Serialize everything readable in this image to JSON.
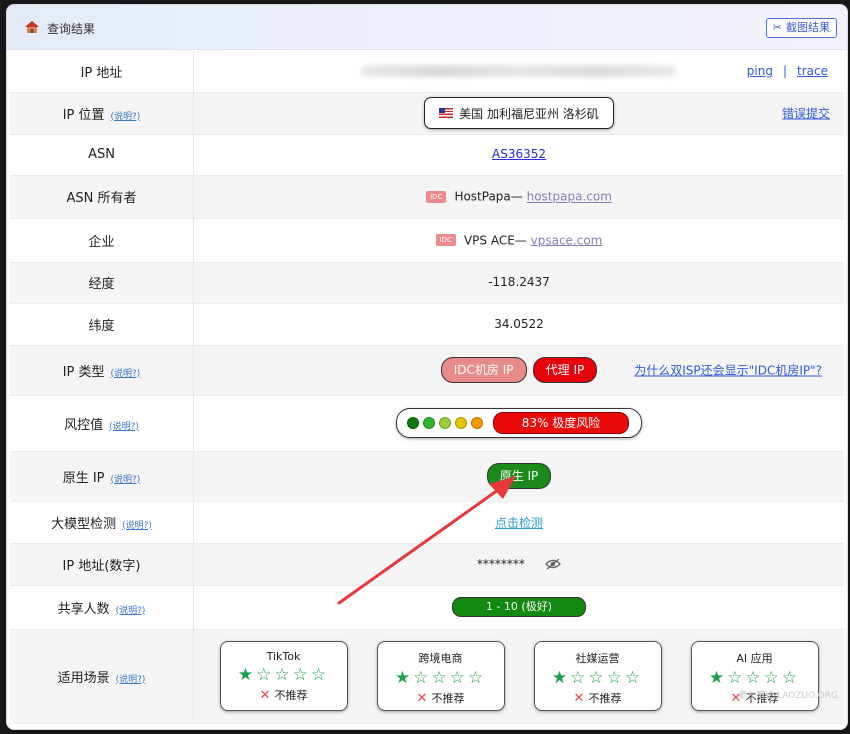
{
  "header": {
    "title": "查询结果",
    "screenshot_btn": "截图结果",
    "icon": "house-icon"
  },
  "help_label": "(说明?)",
  "rows": {
    "ip_address": {
      "label": "IP 地址",
      "ping": "ping",
      "sep": "|",
      "trace": "trace"
    },
    "ip_location": {
      "label": "IP 位置",
      "value": "美国 加利福尼亚州 洛杉矶",
      "report": "错误提交"
    },
    "asn": {
      "label": "ASN",
      "value": "AS36352"
    },
    "asn_owner": {
      "label": "ASN 所有者",
      "tag": "IDC",
      "name": "HostPapa—",
      "domain": "hostpapa.com"
    },
    "company": {
      "label": "企业",
      "tag": "IDC",
      "name": "VPS ACE—",
      "domain": "vpsace.com"
    },
    "longitude": {
      "label": "经度",
      "value": "-118.2437"
    },
    "latitude": {
      "label": "纬度",
      "value": "34.0522"
    },
    "ip_type": {
      "label": "IP 类型",
      "tag1": "IDC机房 IP",
      "tag2": "代理 IP",
      "link": "为什么双ISP还会显示\"IDC机房IP\"?"
    },
    "risk": {
      "label": "风控值",
      "value": "83%  极度风险",
      "score": 83,
      "dots": [
        "#0d7a0d",
        "#2fb52f",
        "#9ccc3a",
        "#e4c400",
        "#f29a00"
      ]
    },
    "native_ip": {
      "label": "原生 IP",
      "value": "原生 IP"
    },
    "llm_check": {
      "label": "大模型检测",
      "value": "点击检测"
    },
    "ip_numeric": {
      "label": "IP 地址(数字)",
      "value": "********"
    },
    "shared_users": {
      "label": "共享人数",
      "value": "1 - 10 (极好)"
    },
    "scenarios": {
      "label": "适用场景",
      "items": [
        {
          "name": "TikTok",
          "stars_filled": 1,
          "stars_total": 5,
          "verdict": "不推荐"
        },
        {
          "name": "跨境电商",
          "stars_filled": 1,
          "stars_total": 5,
          "verdict": "不推荐"
        },
        {
          "name": "社媒运营",
          "stars_filled": 1,
          "stars_total": 5,
          "verdict": "不推荐"
        },
        {
          "name": "AI 应用",
          "stars_filled": 1,
          "stars_total": 5,
          "verdict": "不推荐"
        }
      ],
      "watermark": "老左笔记 LAOZUO.ORG"
    }
  },
  "colors": {
    "accent": "#2e5bd6",
    "danger": "#e8000a",
    "ok": "#128a12"
  }
}
